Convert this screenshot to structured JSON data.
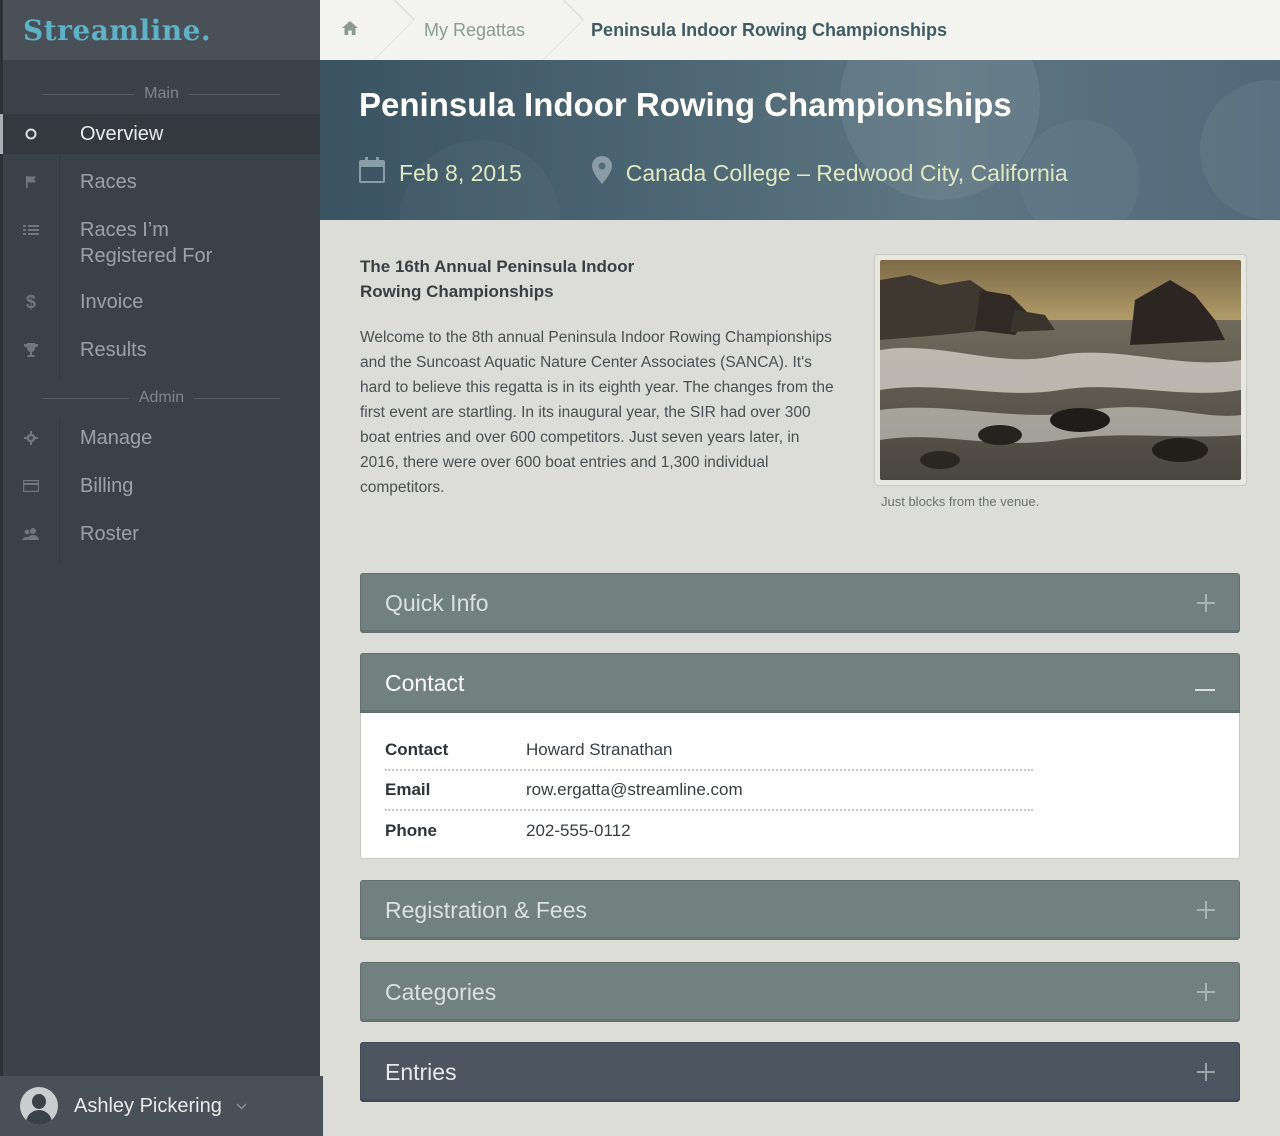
{
  "brand": {
    "name": "Streamline."
  },
  "sidebar": {
    "sections": {
      "main": "Main",
      "admin": "Admin"
    },
    "main_items": [
      {
        "label": "Overview",
        "icon": "circle-icon",
        "active": true
      },
      {
        "label": "Races",
        "icon": "flag-icon"
      },
      {
        "label": "Races I’m Registered For",
        "icon": "list-icon"
      },
      {
        "label": "Invoice",
        "icon": "dollar-icon"
      },
      {
        "label": "Results",
        "icon": "trophy-icon"
      }
    ],
    "admin_items": [
      {
        "label": "Manage",
        "icon": "gear-icon"
      },
      {
        "label": "Billing",
        "icon": "credit-card-icon"
      },
      {
        "label": "Roster",
        "icon": "users-icon"
      }
    ],
    "user": {
      "name": "Ashley Pickering"
    }
  },
  "breadcrumb": {
    "items": [
      "My Regattas",
      "Peninsula Indoor Rowing Championships"
    ]
  },
  "hero": {
    "title": "Peninsula Indoor Rowing Championships",
    "date": "Feb 8, 2015",
    "location": "Canada College – Redwood City, California"
  },
  "intro": {
    "title": "The 16th Annual Peninsula Indoor Rowing Championships",
    "body": "Welcome to the 8th annual Peninsula Indoor Rowing Championships and the Suncoast Aquatic Nature Center Associates (SANCA).  It's hard to believe this regatta is in its eighth year.  The changes from the first event are startling.  In its inaugural year, the SIR had over 300 boat entries and over 600 competitors.  Just seven years later, in 2016, there were over 600 boat entries and 1,300 individual competitors.",
    "caption": "Just blocks from the venue."
  },
  "accordions": [
    {
      "label": "Quick Info",
      "icon": "plus-icon"
    },
    {
      "label": "Contact",
      "icon": "minus-icon",
      "open": true
    },
    {
      "label": "Registration & Fees",
      "icon": "plus-icon"
    },
    {
      "label": "Categories",
      "icon": "plus-icon"
    },
    {
      "label": "Entries",
      "icon": "plus-icon"
    }
  ],
  "contact": [
    {
      "key": "Contact",
      "value": "Howard Stranathan"
    },
    {
      "key": "Email",
      "value": "row.ergatta@streamline.com"
    },
    {
      "key": "Phone",
      "value": "202-555-0112"
    }
  ],
  "colors": {
    "brand": "#5fb2c5",
    "sidebar": "#3b4148",
    "accordion": "#728080",
    "accordion_dark": "#4d5560",
    "hero_meta": "#dfe8c2"
  }
}
